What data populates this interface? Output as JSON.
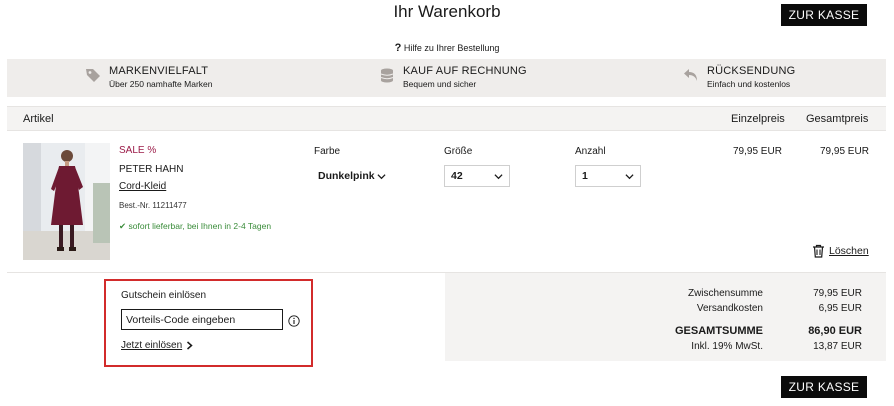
{
  "header": {
    "title": "Ihr Warenkorb",
    "checkout_label": "ZUR KASSE"
  },
  "help": {
    "icon": "?",
    "text": "Hilfe zu Ihrer Bestellung"
  },
  "benefits": [
    {
      "icon": "tag-icon",
      "title": "MARKENVIELFALT",
      "subtitle": "Über 250 namhafte Marken"
    },
    {
      "icon": "coins-icon",
      "title": "KAUF AUF RECHNUNG",
      "subtitle": "Bequem und sicher"
    },
    {
      "icon": "return-arrow-icon",
      "title": "RÜCKSENDUNG",
      "subtitle": "Einfach und kostenlos"
    }
  ],
  "table": {
    "col_article": "Artikel",
    "col_unit_price": "Einzelpreis",
    "col_total_price": "Gesamtpreis"
  },
  "item": {
    "badge": "SALE %",
    "brand": "PETER HAHN",
    "name": "Cord-Kleid",
    "article_no": "Best.-Nr. 11211477",
    "availability": "sofort lieferbar, bei Ihnen in 2-4 Tagen",
    "color_label": "Farbe",
    "color_value": "Dunkelpink",
    "size_label": "Größe",
    "size_value": "42",
    "qty_label": "Anzahl",
    "qty_value": "1",
    "unit_price": "79,95 EUR",
    "total_price": "79,95 EUR",
    "delete_label": "Löschen"
  },
  "voucher": {
    "title": "Gutschein einlösen",
    "placeholder": "Vorteils-Code eingeben",
    "redeem_label": "Jetzt einlösen"
  },
  "summary": {
    "subtotal_label": "Zwischensumme",
    "subtotal_value": "79,95 EUR",
    "shipping_label": "Versandkosten",
    "shipping_value": "6,95 EUR",
    "total_label": "GESAMTSUMME",
    "total_value": "86,90 EUR",
    "vat_label": "Inkl. 19% MwSt.",
    "vat_value": "13,87 EUR"
  },
  "colors": {
    "sale": "#9b1b48",
    "stock": "#3a8c3a",
    "highlight_border": "#d22b2b",
    "button_bg": "#0b0b0b"
  }
}
